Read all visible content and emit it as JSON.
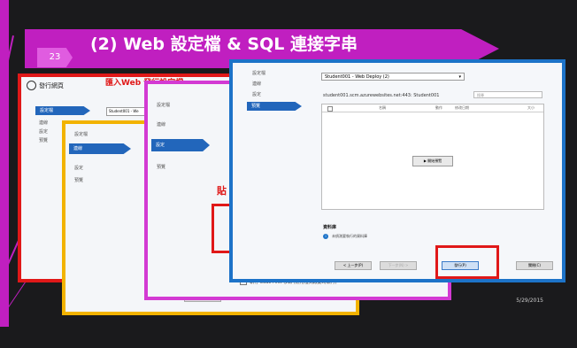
{
  "slide": {
    "number": "23",
    "title": "(2) Web 設定檔 & SQL 連接字串",
    "date": "5/29/2015"
  },
  "frame_red": {
    "header_title": "發行網頁",
    "annotation": "匯入Web 發行設定檔",
    "nav": [
      "設定檔",
      "連線",
      "設定",
      "預覽"
    ],
    "profile_value": "Student001 - We"
  },
  "frame_yellow": {
    "nav": [
      "設定檔",
      "連線",
      "設定",
      "預覽"
    ]
  },
  "frame_magenta": {
    "nav": [
      "設定檔",
      "連線",
      "設定",
      "預覽"
    ],
    "paste_label": "貼",
    "codefirst_label": "執行 Code First 移轉 (應用程式啟動時執行)"
  },
  "frame_blue": {
    "nav": [
      "設定檔",
      "連線",
      "設定",
      "預覽"
    ],
    "profile_select": "Student001 - Web Deploy (2)",
    "url": "student001.scm.azurewebsites.net:443: Student001",
    "filter_placeholder": "搜尋",
    "columns": [
      "動作",
      "修改日期",
      "大小"
    ],
    "col_name": "名稱",
    "preview_button": "▶ 開始預覽",
    "db_title": "資料庫",
    "db_message": "未偵測要執行的資料庫",
    "buttons": {
      "prev": "< 上一步(P)",
      "next": "下一步(N) >",
      "publish": "發行(P)",
      "close": "關閉(C)"
    }
  }
}
